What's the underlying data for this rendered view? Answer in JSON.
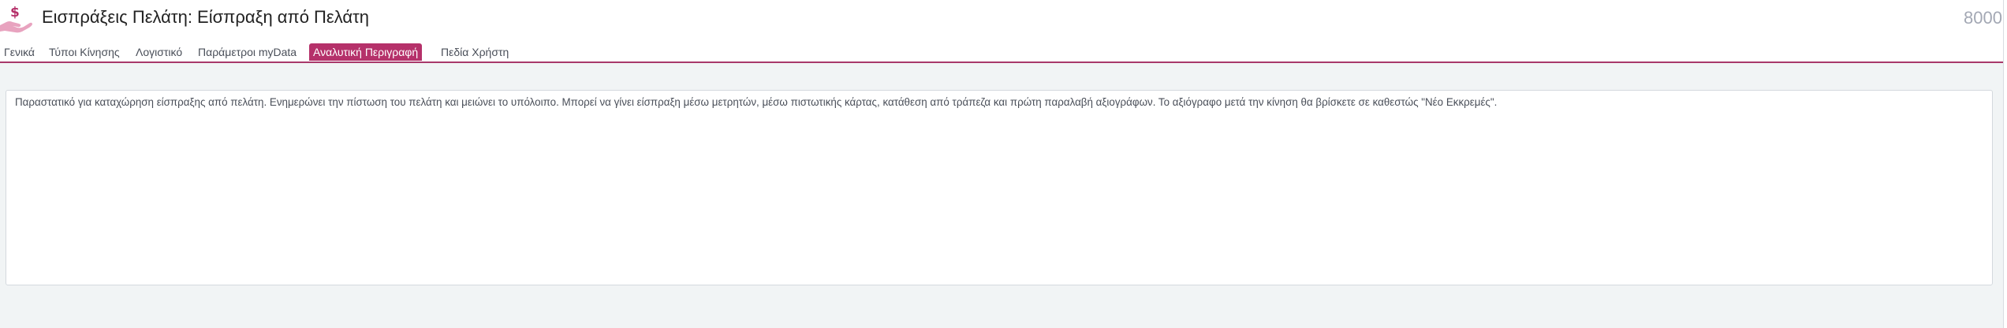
{
  "header": {
    "title": "Εισπράξεις Πελάτη: Είσπραξη από Πελάτη",
    "code": "8000",
    "icon": "hand-money-icon"
  },
  "tabs": [
    {
      "label": "Γενικά",
      "active": false
    },
    {
      "label": "Τύποι Κίνησης",
      "active": false
    },
    {
      "label": "Λογιστικό",
      "active": false
    },
    {
      "label": "Παράμετροι myData",
      "active": false
    },
    {
      "label": "Αναλυτική Περιγραφή",
      "active": true
    },
    {
      "label": "Πεδία Χρήστη",
      "active": false
    }
  ],
  "description": {
    "text": "Παραστατικό για καταχώρηση είσπραξης από πελάτη. Ενημερώνει την πίστωση του πελάτη και μειώνει το υπόλοιπο. Μπορεί να γίνει είσπραξη μέσω μετρητών, μέσω πιστωτικής κάρτας, κατάθεση από τράπεζα και πρώτη παραλαβή αξιογράφων. Το αξιόγραφο μετά την κίνηση θα βρίσκετε σε καθεστώς \"Νέο Εκκρεμές\"."
  },
  "colors": {
    "accent": "#b5316a",
    "icon_pink": "#e8a3bf",
    "icon_dollar": "#b5316a",
    "background": "#f1f4f5"
  }
}
